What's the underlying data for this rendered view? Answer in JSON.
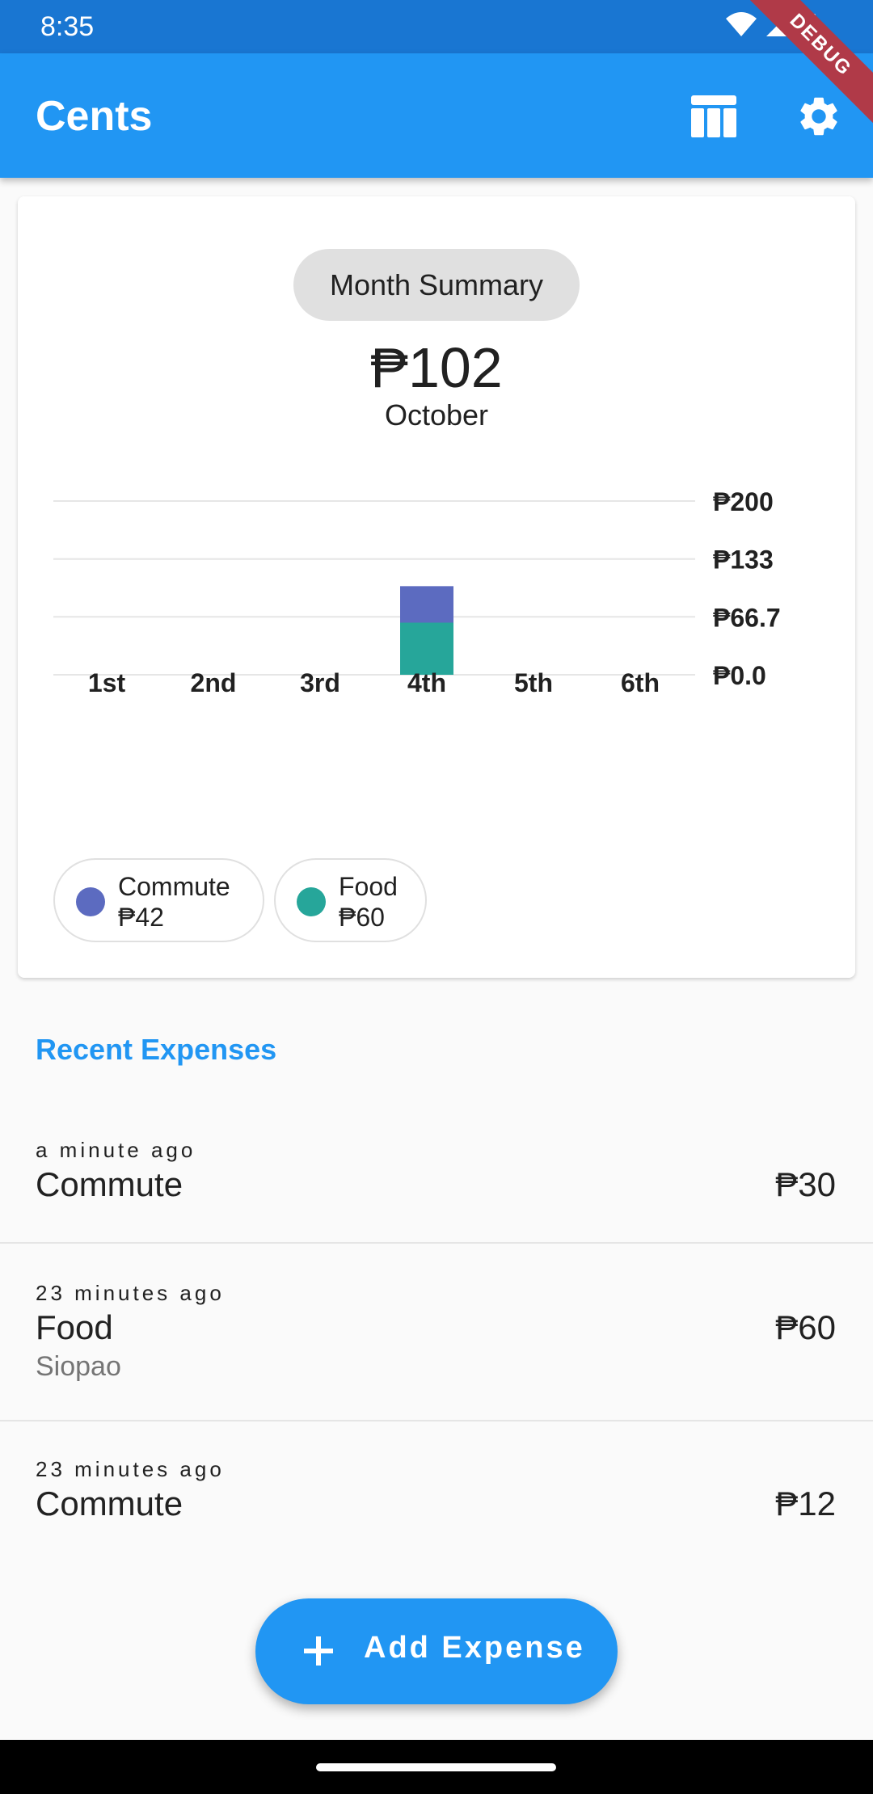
{
  "status_bar": {
    "time": "8:35",
    "debug_label": "DEBUG"
  },
  "app_bar": {
    "title": "Cents",
    "table_icon": "table-icon",
    "settings_icon": "gear-icon"
  },
  "summary": {
    "pill_label": "Month Summary",
    "total": "₱102",
    "month": "October"
  },
  "chart_data": {
    "type": "bar",
    "stacked": true,
    "categories": [
      "1st",
      "2nd",
      "3rd",
      "4th",
      "5th",
      "6th"
    ],
    "series": [
      {
        "name": "Food",
        "color": "#26A69A",
        "values": [
          0,
          0,
          0,
          60,
          0,
          0
        ]
      },
      {
        "name": "Commute",
        "color": "#5C6BC0",
        "values": [
          0,
          0,
          0,
          42,
          0,
          0
        ]
      }
    ],
    "y_ticks": [
      "₱200",
      "₱133",
      "₱66.7",
      "₱0.0"
    ],
    "y_tick_values": [
      200,
      133.3,
      66.7,
      0
    ],
    "ylim": [
      0,
      200
    ],
    "grid": true,
    "y_axis_side": "right"
  },
  "legend": [
    {
      "name": "Commute",
      "amount": "₱42",
      "color": "#5C6BC0"
    },
    {
      "name": "Food",
      "amount": "₱60",
      "color": "#26A69A"
    }
  ],
  "recent": {
    "title": "Recent Expenses",
    "items": [
      {
        "time": "a minute ago",
        "category": "Commute",
        "note": "",
        "amount": "₱30"
      },
      {
        "time": "23 minutes ago",
        "category": "Food",
        "note": "Siopao",
        "amount": "₱60"
      },
      {
        "time": "23 minutes ago",
        "category": "Commute",
        "note": "",
        "amount": "₱12"
      }
    ]
  },
  "fab": {
    "label": "Add Expense",
    "icon": "plus-icon"
  }
}
